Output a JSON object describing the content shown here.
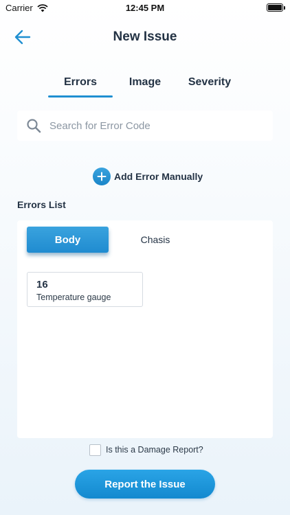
{
  "status_bar": {
    "carrier": "Carrier",
    "time": "12:45 PM",
    "battery_level": 1.0
  },
  "header": {
    "title": "New Issue",
    "back_icon": "arrow-left-icon"
  },
  "tabs": [
    {
      "label": "Errors",
      "active": true
    },
    {
      "label": "Image",
      "active": false
    },
    {
      "label": "Severity",
      "active": false
    }
  ],
  "search": {
    "placeholder": "Search for Error Code",
    "value": "",
    "icon": "search-icon"
  },
  "add_error": {
    "label": "Add Error Manually",
    "icon": "plus-circle-icon"
  },
  "errors_list": {
    "title": "Errors List",
    "segments": [
      {
        "label": "Body",
        "selected": true
      },
      {
        "label": "Chasis",
        "selected": false
      }
    ],
    "items": [
      {
        "code": "16",
        "description": "Temperature gauge"
      }
    ]
  },
  "damage_report": {
    "label": "Is this a Damage Report?",
    "checked": false
  },
  "report_button": {
    "label": "Report the Issue"
  },
  "colors": {
    "accent": "#1f8fd1",
    "title_text": "#233244",
    "background": "#f3f8fc"
  }
}
